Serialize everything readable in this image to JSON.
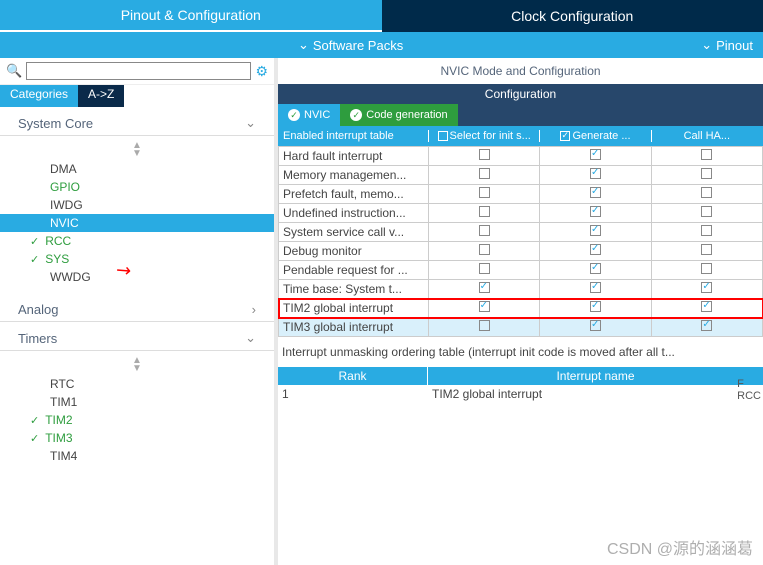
{
  "top_tabs": {
    "pinout": "Pinout & Configuration",
    "clock": "Clock Configuration"
  },
  "sub_bar": {
    "packs": "Software Packs",
    "pinout": "Pinout"
  },
  "search": {
    "placeholder": ""
  },
  "cat_tabs": {
    "categories": "Categories",
    "az": "A->Z"
  },
  "sidebar": {
    "system_core": {
      "label": "System Core",
      "items": [
        {
          "label": "DMA",
          "style": "gray"
        },
        {
          "label": "GPIO",
          "style": "green"
        },
        {
          "label": "IWDG",
          "style": "gray"
        },
        {
          "label": "NVIC",
          "style": "sel"
        },
        {
          "label": "RCC",
          "style": "green",
          "check": true
        },
        {
          "label": "SYS",
          "style": "green",
          "check": true
        },
        {
          "label": "WWDG",
          "style": "gray"
        }
      ]
    },
    "analog": {
      "label": "Analog"
    },
    "timers": {
      "label": "Timers",
      "items": [
        {
          "label": "RTC",
          "style": "gray"
        },
        {
          "label": "TIM1",
          "style": "gray"
        },
        {
          "label": "TIM2",
          "style": "green",
          "check": true
        },
        {
          "label": "TIM3",
          "style": "green",
          "check": true
        },
        {
          "label": "TIM4",
          "style": "gray"
        }
      ]
    }
  },
  "right": {
    "mode_title": "NVIC Mode and Configuration",
    "conf_title": "Configuration",
    "sub_tabs": {
      "nvic": "NVIC",
      "codegen": "Code generation"
    },
    "headers": {
      "c1": "Enabled interrupt table",
      "c2": "Select for init s...",
      "c3": "Generate ...",
      "c4": "Call HA..."
    },
    "rows": [
      {
        "name": "Hard fault interrupt",
        "sel": false,
        "gen": true,
        "call": false
      },
      {
        "name": "Memory managemen...",
        "sel": false,
        "gen": true,
        "call": false
      },
      {
        "name": "Prefetch fault, memo...",
        "sel": false,
        "gen": true,
        "call": false
      },
      {
        "name": "Undefined instruction...",
        "sel": false,
        "gen": true,
        "call": false
      },
      {
        "name": "System service call v...",
        "sel": false,
        "gen": true,
        "call": false
      },
      {
        "name": "Debug monitor",
        "sel": false,
        "gen": true,
        "call": false
      },
      {
        "name": "Pendable request for ...",
        "sel": false,
        "gen": true,
        "call": false
      },
      {
        "name": "Time base: System t...",
        "sel": true,
        "gen": true,
        "call": true
      },
      {
        "name": "TIM2 global interrupt",
        "sel": true,
        "gen": true,
        "call": true,
        "hl": true
      },
      {
        "name": "TIM3 global interrupt",
        "sel": false,
        "gen": true,
        "call": true,
        "selrow": true
      }
    ],
    "note": "Interrupt unmasking ordering table (interrupt init code is moved after all t...",
    "rank_hdr": {
      "rank": "Rank",
      "name": "Interrupt name"
    },
    "rank_row": {
      "rank": "1",
      "name": "TIM2 global interrupt"
    },
    "side": {
      "r": "F",
      "rcc": "RCC"
    }
  },
  "watermark": "CSDN @源的涵涵葛"
}
